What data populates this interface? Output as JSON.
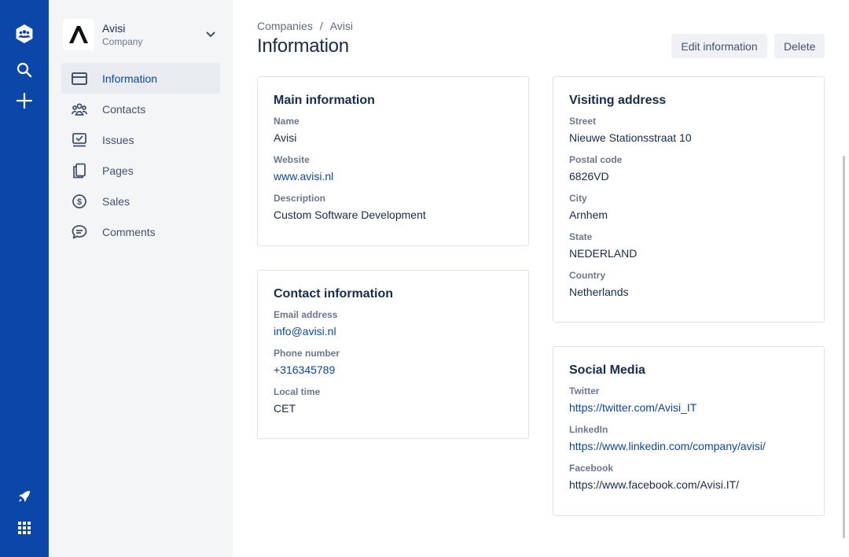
{
  "global_nav": {
    "top_icons": [
      "team-icon",
      "search-icon",
      "plus-icon"
    ],
    "bottom_icons": [
      "rocket-icon",
      "app-grid-icon"
    ]
  },
  "sidebar": {
    "company_name": "Avisi",
    "company_type": "Company",
    "items": [
      {
        "label": "Information",
        "icon": "card-icon",
        "active": true
      },
      {
        "label": "Contacts",
        "icon": "people-icon",
        "active": false
      },
      {
        "label": "Issues",
        "icon": "issues-icon",
        "active": false
      },
      {
        "label": "Pages",
        "icon": "pages-icon",
        "active": false
      },
      {
        "label": "Sales",
        "icon": "dollar-icon",
        "active": false
      },
      {
        "label": "Comments",
        "icon": "comment-icon",
        "active": false
      }
    ]
  },
  "header": {
    "breadcrumb": [
      "Companies",
      "Avisi"
    ],
    "breadcrumb_separator": "/",
    "title": "Information",
    "edit_label": "Edit information",
    "delete_label": "Delete"
  },
  "main_info": {
    "title": "Main information",
    "name_label": "Name",
    "name": "Avisi",
    "website_label": "Website",
    "website": "www.avisi.nl",
    "description_label": "Description",
    "description": "Custom Software Development"
  },
  "contact_info": {
    "title": "Contact information",
    "email_label": "Email address",
    "email": "info@avisi.nl",
    "phone_label": "Phone number",
    "phone": "+316345789",
    "time_label": "Local time",
    "time": "CET"
  },
  "visiting_address": {
    "title": "Visiting address",
    "street_label": "Street",
    "street": "Nieuwe Stationsstraat 10",
    "postal_label": "Postal code",
    "postal": "6826VD",
    "city_label": "City",
    "city": "Arnhem",
    "state_label": "State",
    "state": "NEDERLAND",
    "country_label": "Country",
    "country": "Netherlands"
  },
  "social_media": {
    "title": "Social Media",
    "twitter_label": "Twitter",
    "twitter": "https://twitter.com/Avisi_IT",
    "linkedin_label": "LinkedIn",
    "linkedin": "https://www.linkedin.com/company/avisi/",
    "facebook_label": "Facebook",
    "facebook": "https://www.facebook.com/Avisi.IT/"
  },
  "colors": {
    "global_nav": "#0b47a8",
    "sidebar_bg": "#f4f5f7",
    "active_item_bg": "#e8ebf0",
    "link": "#0b47a8",
    "text": "#172b4d",
    "label": "#6b778c"
  }
}
